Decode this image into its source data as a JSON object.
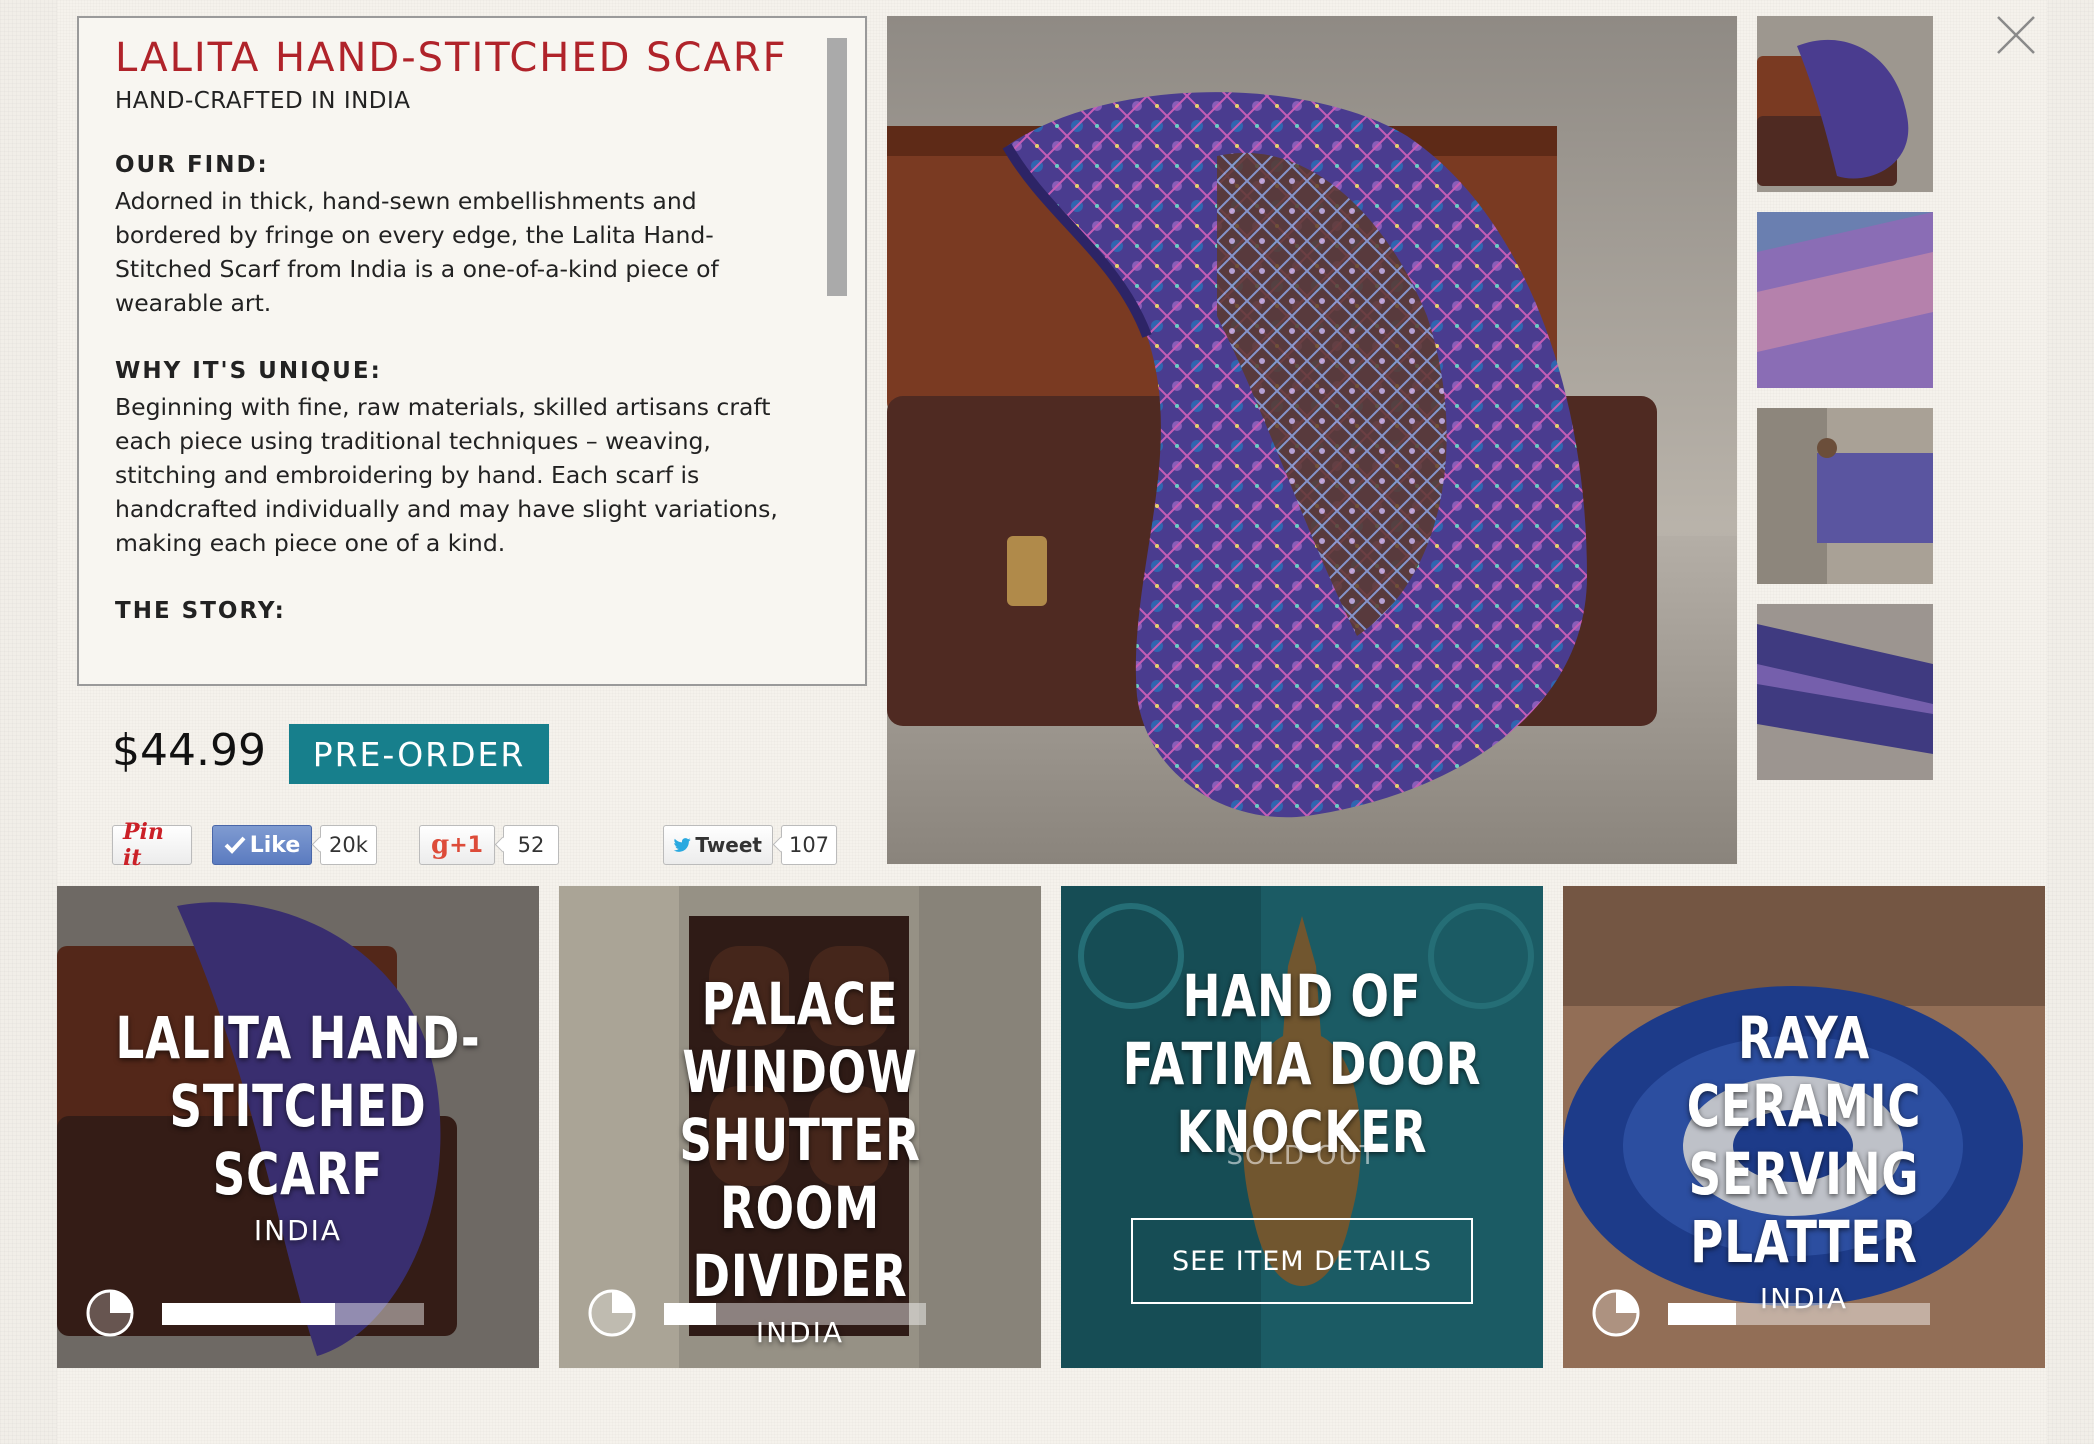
{
  "product": {
    "title": "LALITA HAND-STITCHED SCARF",
    "subtitle": "HAND-CRAFTED IN INDIA",
    "sections": [
      {
        "heading": "OUR FIND:",
        "text": "Adorned in thick, hand-sewn embellishments and bordered by fringe on every edge, the Lalita Hand-Stitched Scarf from India is a one-of-a-kind piece of wearable art."
      },
      {
        "heading": "WHY IT'S UNIQUE:",
        "text": "Beginning with fine, raw materials, skilled artisans craft each piece using traditional techniques – weaving, stitching and embroidering by hand. Each scarf is handcrafted individually and may have slight variations, making each piece one of a kind."
      },
      {
        "heading": "THE STORY:",
        "text": ""
      }
    ],
    "price": "$44.99",
    "order_label": "PRE-ORDER"
  },
  "social": {
    "pinit_label": "Pin it",
    "like_label": "Like",
    "like_count": "20k",
    "gplus_label": "+1",
    "gplus_count": "52",
    "tweet_label": "Tweet",
    "tweet_count": "107"
  },
  "tiles": [
    {
      "title": "LALITA HAND-STITCHED SCARF",
      "origin": "INDIA",
      "progress": 0.66
    },
    {
      "title": "PALACE WINDOW SHUTTER ROOM DIVIDER",
      "origin": "INDIA",
      "progress": 0.2
    },
    {
      "title": "HAND OF FATIMA DOOR KNOCKER",
      "status": "SOLD OUT",
      "details_label": "SEE ITEM DETAILS"
    },
    {
      "title": "RAYA CERAMIC SERVING PLATTER",
      "origin": "INDIA",
      "progress": 0.26
    }
  ],
  "colors": {
    "title_red": "#b0232a",
    "accent_teal": "#177f8c",
    "background": "#f1eee8"
  },
  "icons": {
    "close": "close-icon",
    "timer": "timer-icon",
    "twitter": "twitter-bird-icon",
    "check": "check-icon"
  }
}
